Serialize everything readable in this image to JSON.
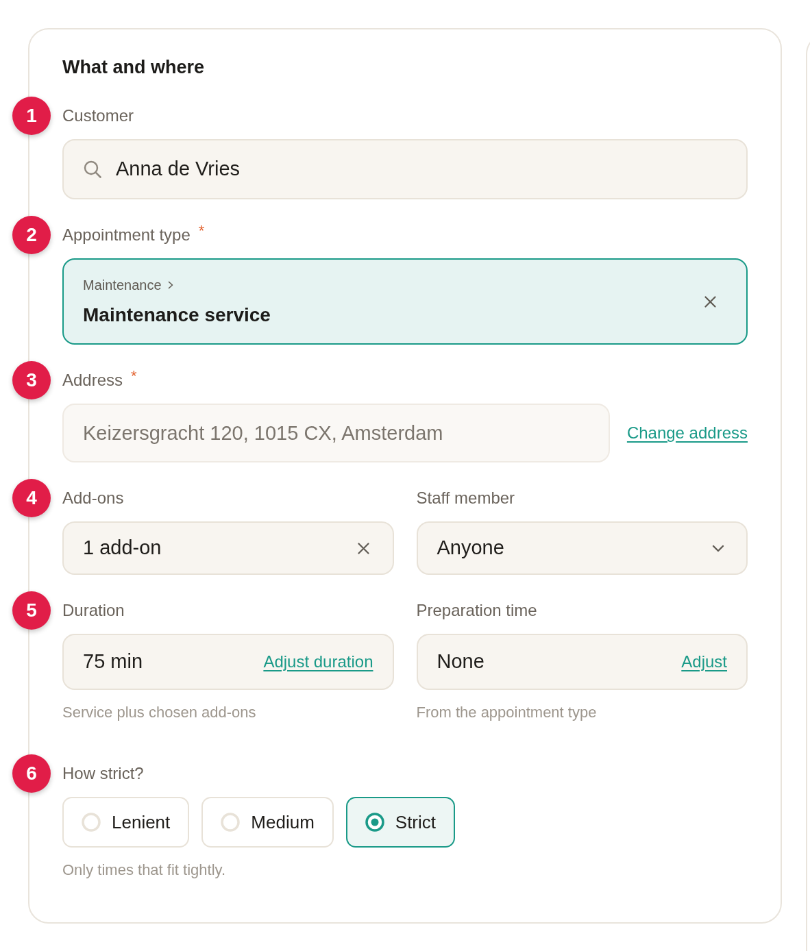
{
  "form": {
    "title": "What and where"
  },
  "sections": [
    {
      "step": "1",
      "kind": "search",
      "label": "Customer",
      "value": "Anna de Vries"
    },
    {
      "step": "2",
      "kind": "selection",
      "label": "Appointment type",
      "required_mark": "*",
      "breadcrumb": "Maintenance",
      "value": "Maintenance service"
    },
    {
      "step": "3",
      "kind": "readonly",
      "label": "Address",
      "required_mark": "*",
      "value": "Keizersgracht 120, 1015 CX, Amsterdam",
      "link": "Change address"
    },
    {
      "step": "4",
      "kind": "pair",
      "fields": [
        {
          "kind": "clearable",
          "label": "Add-ons",
          "value": "1 add-on"
        },
        {
          "kind": "dropdown",
          "label": "Staff member",
          "value": "Anyone"
        }
      ]
    },
    {
      "step": "5",
      "kind": "pair",
      "fields": [
        {
          "kind": "adjustable",
          "label": "Duration",
          "value": "75 min",
          "link": "Adjust duration",
          "hint": "Service plus chosen add-ons"
        },
        {
          "kind": "adjustable",
          "label": "Preparation time",
          "value": "None",
          "link": "Adjust",
          "hint": "From the appointment type"
        }
      ]
    },
    {
      "step": "6",
      "kind": "choice",
      "label": "How strict?",
      "options": [
        {
          "label": "Lenient",
          "selected": false
        },
        {
          "label": "Medium",
          "selected": false
        },
        {
          "label": "Strict",
          "selected": true
        }
      ],
      "hint": "Only times that fit tightly."
    }
  ]
}
